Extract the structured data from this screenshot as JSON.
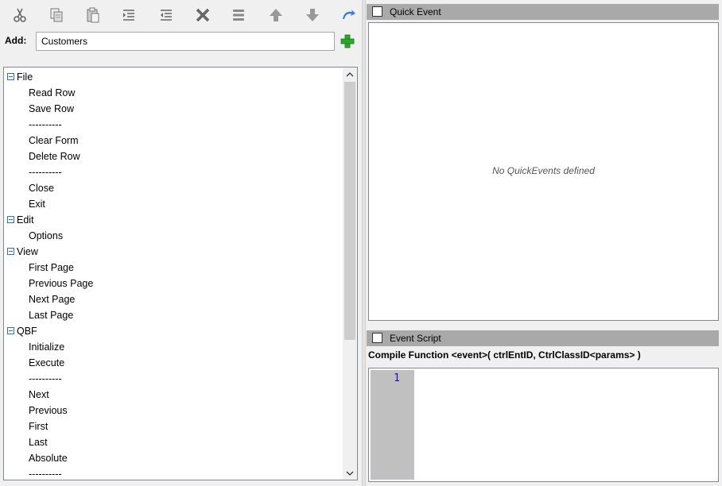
{
  "toolbar": {
    "buttons": [
      {
        "name": "cut-icon"
      },
      {
        "name": "copy-icon"
      },
      {
        "name": "paste-icon"
      },
      {
        "name": "indent-icon"
      },
      {
        "name": "outdent-icon"
      },
      {
        "name": "delete-icon"
      },
      {
        "name": "separator-icon"
      },
      {
        "name": "move-up-icon"
      },
      {
        "name": "move-down-icon"
      },
      {
        "name": "undo-icon"
      }
    ]
  },
  "add": {
    "label": "Add:",
    "value": "Customers"
  },
  "tree": {
    "nodes": [
      {
        "text": "File",
        "level": 0
      },
      {
        "text": "Read Row",
        "level": 1
      },
      {
        "text": "Save Row",
        "level": 1
      },
      {
        "text": "----------",
        "level": 1
      },
      {
        "text": "Clear Form",
        "level": 1
      },
      {
        "text": "Delete Row",
        "level": 1
      },
      {
        "text": "----------",
        "level": 1
      },
      {
        "text": "Close",
        "level": 1
      },
      {
        "text": "Exit",
        "level": 1
      },
      {
        "text": "Edit",
        "level": 0
      },
      {
        "text": "Options",
        "level": 1
      },
      {
        "text": "View",
        "level": 0
      },
      {
        "text": "First Page",
        "level": 1
      },
      {
        "text": "Previous Page",
        "level": 1
      },
      {
        "text": "Next Page",
        "level": 1
      },
      {
        "text": "Last Page",
        "level": 1
      },
      {
        "text": "QBF",
        "level": 0
      },
      {
        "text": "Initialize",
        "level": 1
      },
      {
        "text": "Execute",
        "level": 1
      },
      {
        "text": "----------",
        "level": 1
      },
      {
        "text": "Next",
        "level": 1
      },
      {
        "text": "Previous",
        "level": 1
      },
      {
        "text": "First",
        "level": 1
      },
      {
        "text": "Last",
        "level": 1
      },
      {
        "text": "Absolute",
        "level": 1
      },
      {
        "text": "----------",
        "level": 1
      }
    ]
  },
  "quick_event": {
    "title": "Quick Event",
    "empty_message": "No QuickEvents defined"
  },
  "event_script": {
    "title": "Event Script",
    "compile_text": "Compile Function <event>( ctrlEntID, CtrlClassID<params> )",
    "line_number": "1"
  },
  "colors": {
    "header_bg": "#a9a9a9",
    "add_plus": "#2fa52f",
    "gutter": "#c0c0c0",
    "line_number": "#1010d0"
  }
}
